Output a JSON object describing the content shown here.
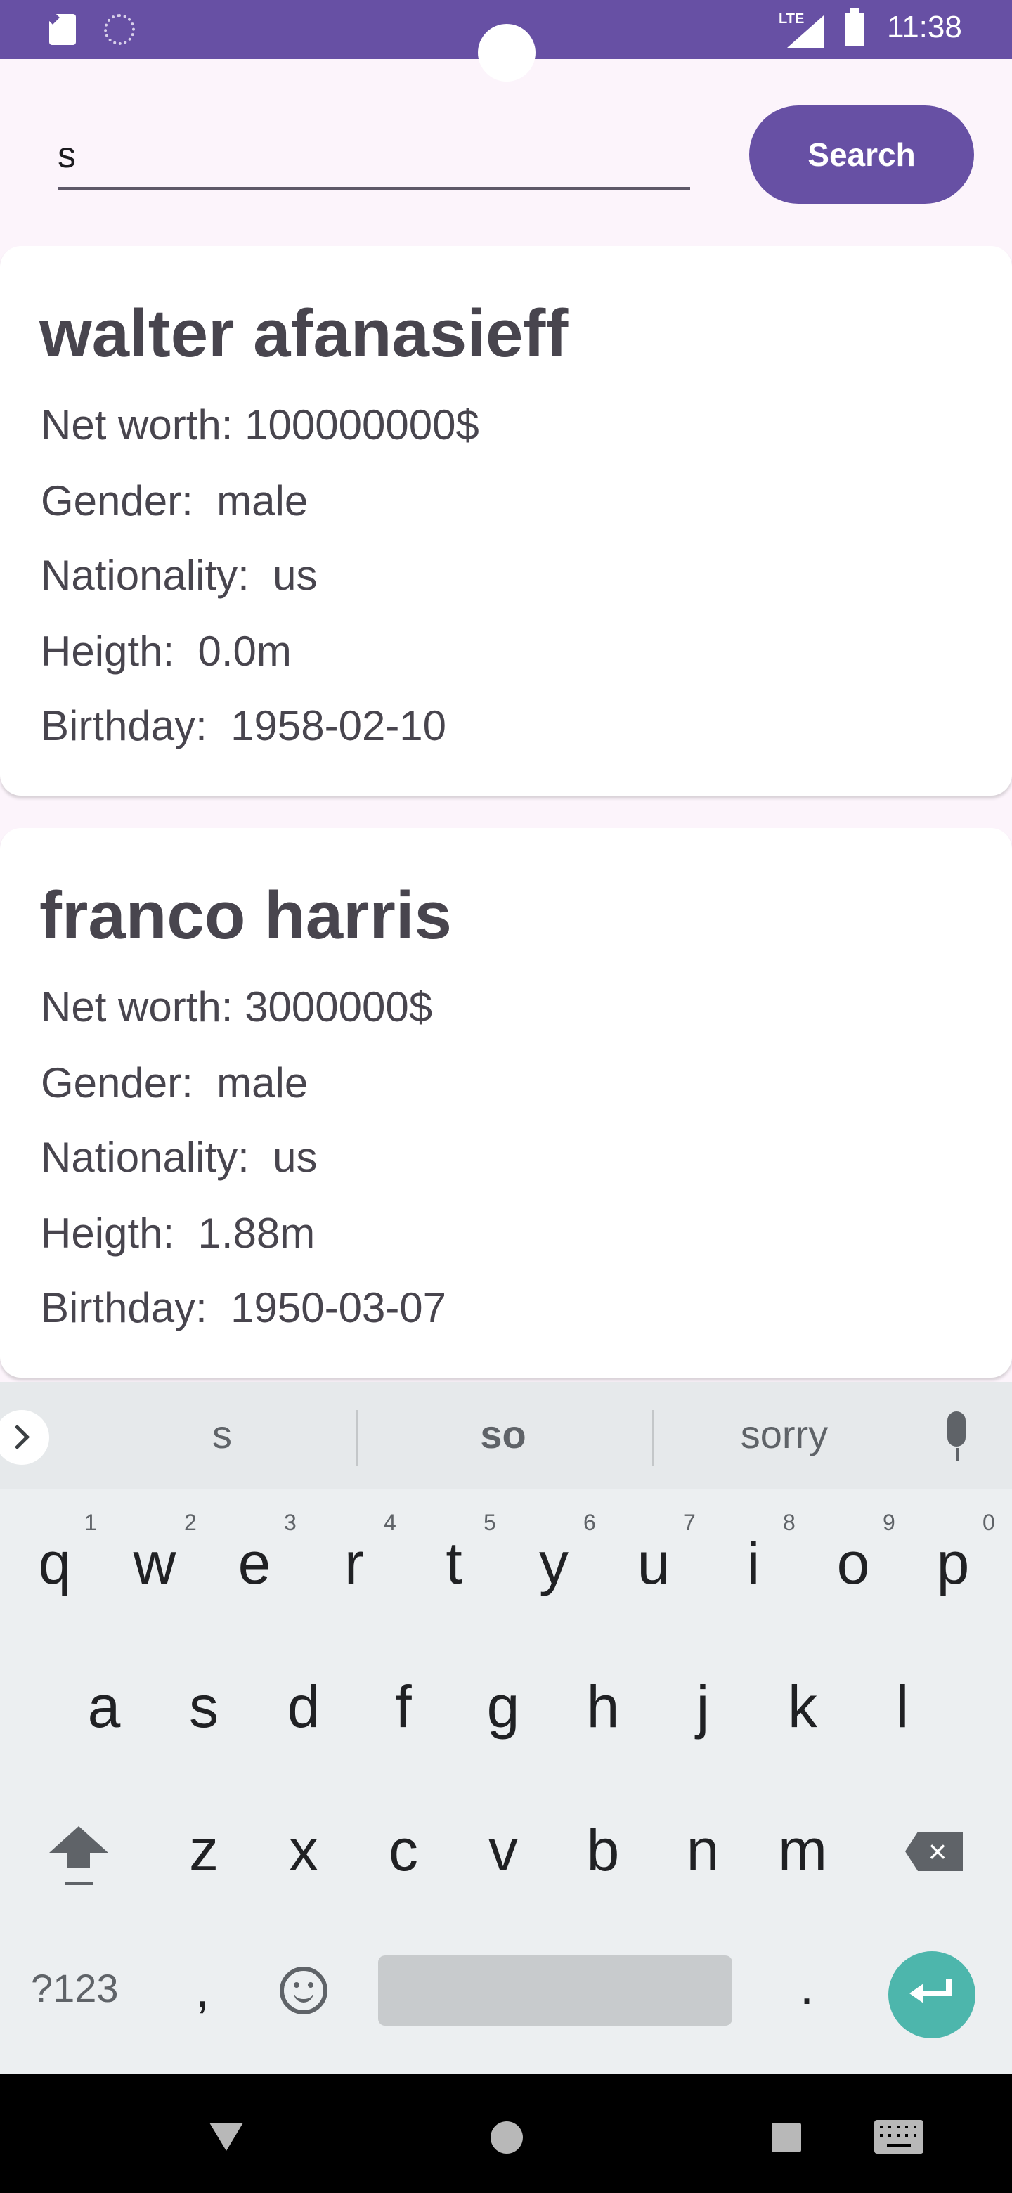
{
  "status_bar": {
    "time": "11:38",
    "network": "LTE",
    "icons": [
      "sd-card-icon",
      "sync-icon",
      "signal-icon",
      "battery-icon"
    ]
  },
  "search": {
    "value": "s",
    "button_label": "Search"
  },
  "results": [
    {
      "name": "walter afanasieff",
      "net_worth_label": "Net worth:",
      "net_worth": "100000000$",
      "gender_label": "Gender:",
      "gender": "male",
      "nationality_label": "Nationality:",
      "nationality": "us",
      "height_label": "Heigth:",
      "height": "0.0m",
      "birthday_label": "Birthday:",
      "birthday": "1958-02-10"
    },
    {
      "name": "franco harris",
      "net_worth_label": "Net worth:",
      "net_worth": "3000000$",
      "gender_label": "Gender:",
      "gender": "male",
      "nationality_label": "Nationality:",
      "nationality": "us",
      "height_label": "Heigth:",
      "height": "1.88m",
      "birthday_label": "Birthday:",
      "birthday": "1950-03-07"
    }
  ],
  "keyboard": {
    "suggestions": [
      "s",
      "so",
      "sorry"
    ],
    "row1": [
      "q",
      "w",
      "e",
      "r",
      "t",
      "y",
      "u",
      "i",
      "o",
      "p"
    ],
    "row1_hints": [
      "1",
      "2",
      "3",
      "4",
      "5",
      "6",
      "7",
      "8",
      "9",
      "0"
    ],
    "row2": [
      "a",
      "s",
      "d",
      "f",
      "g",
      "h",
      "j",
      "k",
      "l"
    ],
    "row3": [
      "z",
      "x",
      "c",
      "v",
      "b",
      "n",
      "m"
    ],
    "symbols_label": "?123",
    "comma": ",",
    "period": ".",
    "backspace_glyph": "×"
  },
  "colors": {
    "primary": "#6750a4",
    "background": "#fcf4fb",
    "card": "#ffffff",
    "text": "#48454e",
    "enter": "#4db6ac",
    "keyboard_bg": "#eceff1"
  }
}
